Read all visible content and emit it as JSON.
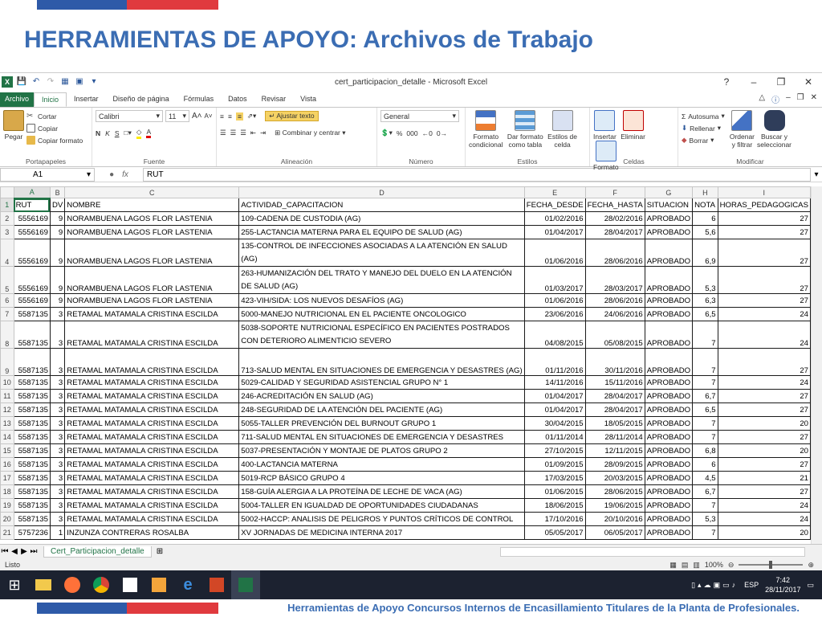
{
  "slide": {
    "title": "HERRAMIENTAS DE APOYO: Archivos de Trabajo",
    "footer": "Herramientas de Apoyo Concursos Internos de Encasillamiento Titulares de la Planta de Profesionales.",
    "accent_blue": "#2e5aa8",
    "accent_red": "#e03a3e",
    "title_color": "#3b6db3"
  },
  "excel": {
    "window_title": "cert_participacion_detalle - Microsoft Excel",
    "tabs": [
      "Archivo",
      "Inicio",
      "Insertar",
      "Diseño de página",
      "Fórmulas",
      "Datos",
      "Revisar",
      "Vista"
    ],
    "clipboard": {
      "paste": "Pegar",
      "cut": "Cortar",
      "copy": "Copiar",
      "format_painter": "Copiar formato",
      "label": "Portapapeles"
    },
    "font": {
      "name": "Calibri",
      "size": "11",
      "label": "Fuente"
    },
    "alignment": {
      "wrap": "Ajustar texto",
      "merge": "Combinar y centrar",
      "label": "Alineación"
    },
    "number": {
      "format": "General",
      "label": "Número"
    },
    "styles": {
      "conditional_1": "Formato",
      "conditional_2": "condicional",
      "table_1": "Dar formato",
      "table_2": "como tabla",
      "cell_1": "Estilos de",
      "cell_2": "celda",
      "label": "Estilos"
    },
    "cells": {
      "insert": "Insertar",
      "delete": "Eliminar",
      "format": "Formato",
      "label": "Celdas"
    },
    "editing": {
      "autosum": "Autosuma",
      "fill": "Rellenar",
      "clear": "Borrar",
      "sort_1": "Ordenar",
      "sort_2": "y filtrar",
      "find_1": "Buscar y",
      "find_2": "seleccionar",
      "label": "Modificar"
    },
    "name_box": "A1",
    "formula": "RUT",
    "fx": "fx",
    "columns": [
      "A",
      "B",
      "C",
      "D",
      "E",
      "F",
      "G",
      "H",
      "I"
    ],
    "headers": [
      "RUT",
      "DV",
      "NOMBRE",
      "ACTIVIDAD_CAPACITACION",
      "FECHA_DESDE",
      "FECHA_HASTA",
      "SITUACION",
      "NOTA",
      "HORAS_PEDAGOGICAS"
    ],
    "rows": [
      {
        "n": "2",
        "rut": "5556169",
        "dv": "9",
        "nombre": "NORAMBUENA LAGOS FLOR LASTENIA",
        "act": "109-CADENA DE CUSTODIA (AG)",
        "desde": "01/02/2016",
        "hasta": "28/02/2016",
        "sit": "APROBADO",
        "nota": "6",
        "horas": "27"
      },
      {
        "n": "3",
        "rut": "5556169",
        "dv": "9",
        "nombre": "NORAMBUENA LAGOS FLOR LASTENIA",
        "act": "255-LACTANCIA MATERNA PARA EL EQUIPO DE SALUD (AG)",
        "desde": "01/04/2017",
        "hasta": "28/04/2017",
        "sit": "APROBADO",
        "nota": "5,6",
        "horas": "27"
      },
      {
        "n": "4",
        "rut": "5556169",
        "dv": "9",
        "nombre": "NORAMBUENA LAGOS FLOR LASTENIA",
        "act": "135-CONTROL DE INFECCIONES ASOCIADAS A LA ATENCIÓN EN SALUD (AG)",
        "desde": "01/06/2016",
        "hasta": "28/06/2016",
        "sit": "APROBADO",
        "nota": "6,9",
        "horas": "27"
      },
      {
        "n": "5",
        "rut": "5556169",
        "dv": "9",
        "nombre": "NORAMBUENA LAGOS FLOR LASTENIA",
        "act": "263-HUMANIZACIÓN DEL TRATO Y MANEJO DEL DUELO EN LA ATENCIÓN DE SALUD (AG)",
        "desde": "01/03/2017",
        "hasta": "28/03/2017",
        "sit": "APROBADO",
        "nota": "5,3",
        "horas": "27"
      },
      {
        "n": "6",
        "rut": "5556169",
        "dv": "9",
        "nombre": "NORAMBUENA LAGOS FLOR LASTENIA",
        "act": "423-VIH/SIDA: LOS NUEVOS DESAFÍOS (AG)",
        "desde": "01/06/2016",
        "hasta": "28/06/2016",
        "sit": "APROBADO",
        "nota": "6,3",
        "horas": "27"
      },
      {
        "n": "7",
        "rut": "5587135",
        "dv": "3",
        "nombre": "RETAMAL MATAMALA CRISTINA ESCILDA",
        "act": "5000-MANEJO NUTRICIONAL EN EL PACIENTE ONCOLOGICO",
        "desde": "23/06/2016",
        "hasta": "24/06/2016",
        "sit": "APROBADO",
        "nota": "6,5",
        "horas": "24"
      },
      {
        "n": "8",
        "rut": "5587135",
        "dv": "3",
        "nombre": "RETAMAL MATAMALA CRISTINA ESCILDA",
        "act": "5038-SOPORTE NUTRICIONAL ESPECÍFICO EN PACIENTES POSTRADOS CON DETERIORO ALIMENTICIO SEVERO",
        "desde": "04/08/2015",
        "hasta": "05/08/2015",
        "sit": "APROBADO",
        "nota": "7",
        "horas": "24"
      },
      {
        "n": "9",
        "rut": "5587135",
        "dv": "3",
        "nombre": "RETAMAL MATAMALA CRISTINA ESCILDA",
        "act": "713-SALUD MENTAL EN SITUACIONES DE EMERGENCIA Y DESASTRES (AG)",
        "desde": "01/11/2016",
        "hasta": "30/11/2016",
        "sit": "APROBADO",
        "nota": "7",
        "horas": "27"
      },
      {
        "n": "10",
        "rut": "5587135",
        "dv": "3",
        "nombre": "RETAMAL MATAMALA CRISTINA ESCILDA",
        "act": "5029-CALIDAD Y SEGURIDAD ASISTENCIAL GRUPO N° 1",
        "desde": "14/11/2016",
        "hasta": "15/11/2016",
        "sit": "APROBADO",
        "nota": "7",
        "horas": "24"
      },
      {
        "n": "11",
        "rut": "5587135",
        "dv": "3",
        "nombre": "RETAMAL MATAMALA CRISTINA ESCILDA",
        "act": "246-ACREDITACIÓN EN SALUD (AG)",
        "desde": "01/04/2017",
        "hasta": "28/04/2017",
        "sit": "APROBADO",
        "nota": "6,7",
        "horas": "27"
      },
      {
        "n": "12",
        "rut": "5587135",
        "dv": "3",
        "nombre": "RETAMAL MATAMALA CRISTINA ESCILDA",
        "act": "248-SEGURIDAD DE LA ATENCIÓN DEL PACIENTE (AG)",
        "desde": "01/04/2017",
        "hasta": "28/04/2017",
        "sit": "APROBADO",
        "nota": "6,5",
        "horas": "27"
      },
      {
        "n": "13",
        "rut": "5587135",
        "dv": "3",
        "nombre": "RETAMAL MATAMALA CRISTINA ESCILDA",
        "act": "5055-TALLER PREVENCIÓN DEL BURNOUT GRUPO 1",
        "desde": "30/04/2015",
        "hasta": "18/05/2015",
        "sit": "APROBADO",
        "nota": "7",
        "horas": "20"
      },
      {
        "n": "14",
        "rut": "5587135",
        "dv": "3",
        "nombre": "RETAMAL MATAMALA CRISTINA ESCILDA",
        "act": "711-SALUD MENTAL EN SITUACIONES DE EMERGENCIA Y DESASTRES",
        "desde": "01/11/2014",
        "hasta": "28/11/2014",
        "sit": "APROBADO",
        "nota": "7",
        "horas": "27"
      },
      {
        "n": "15",
        "rut": "5587135",
        "dv": "3",
        "nombre": "RETAMAL MATAMALA CRISTINA ESCILDA",
        "act": "5037-PRESENTACIÓN Y MONTAJE DE PLATOS GRUPO 2",
        "desde": "27/10/2015",
        "hasta": "12/11/2015",
        "sit": "APROBADO",
        "nota": "6,8",
        "horas": "20"
      },
      {
        "n": "16",
        "rut": "5587135",
        "dv": "3",
        "nombre": "RETAMAL MATAMALA CRISTINA ESCILDA",
        "act": "400-LACTANCIA MATERNA",
        "desde": "01/09/2015",
        "hasta": "28/09/2015",
        "sit": "APROBADO",
        "nota": "6",
        "horas": "27"
      },
      {
        "n": "17",
        "rut": "5587135",
        "dv": "3",
        "nombre": "RETAMAL MATAMALA CRISTINA ESCILDA",
        "act": "5019-RCP BÁSICO GRUPO 4",
        "desde": "17/03/2015",
        "hasta": "20/03/2015",
        "sit": "APROBADO",
        "nota": "4,5",
        "horas": "21"
      },
      {
        "n": "18",
        "rut": "5587135",
        "dv": "3",
        "nombre": "RETAMAL MATAMALA CRISTINA ESCILDA",
        "act": "158-GUÍA ALERGIA A LA PROTEÍNA DE LECHE DE VACA (AG)",
        "desde": "01/06/2015",
        "hasta": "28/06/2015",
        "sit": "APROBADO",
        "nota": "6,7",
        "horas": "27"
      },
      {
        "n": "19",
        "rut": "5587135",
        "dv": "3",
        "nombre": "RETAMAL MATAMALA CRISTINA ESCILDA",
        "act": "5004-TALLER EN IGUALDAD DE OPORTUNIDADES CIUDADANAS",
        "desde": "18/06/2015",
        "hasta": "19/06/2015",
        "sit": "APROBADO",
        "nota": "7",
        "horas": "24"
      },
      {
        "n": "20",
        "rut": "5587135",
        "dv": "3",
        "nombre": "RETAMAL MATAMALA CRISTINA ESCILDA",
        "act": "5002-HACCP: ANALISIS DE PELIGROS Y PUNTOS CRÍTICOS DE CONTROL",
        "desde": "17/10/2016",
        "hasta": "20/10/2016",
        "sit": "APROBADO",
        "nota": "5,3",
        "horas": "24"
      },
      {
        "n": "21",
        "rut": "5757236",
        "dv": "1",
        "nombre": "INZUNZA CONTRERAS ROSALBA",
        "act": "XV JORNADAS DE MEDICINA INTERNA 2017",
        "desde": "05/05/2017",
        "hasta": "06/05/2017",
        "sit": "APROBADO",
        "nota": "7",
        "horas": "20"
      }
    ],
    "sheet_tab": "Cert_Participacion_detalle",
    "status": "Listo",
    "zoom": "100%"
  },
  "taskbar": {
    "time": "7:42",
    "date": "28/11/2017",
    "lang": "ESP"
  }
}
